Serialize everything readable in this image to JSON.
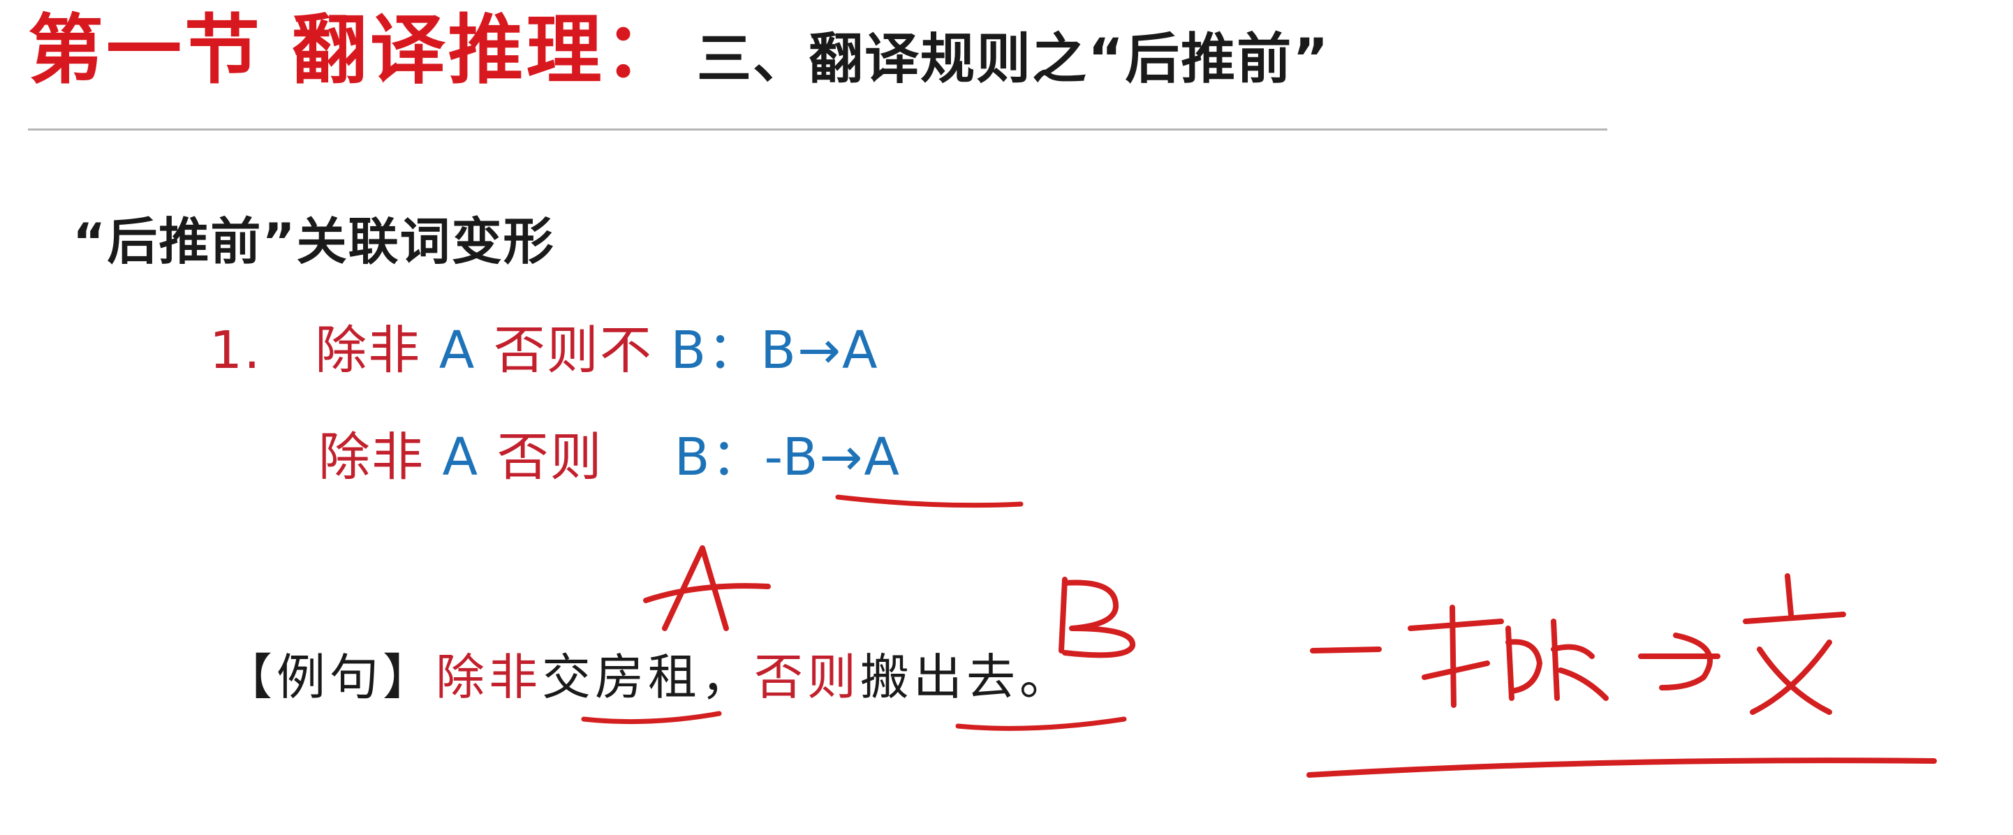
{
  "title": {
    "section": "第一节 翻译推理：",
    "topic": "三、翻译规则之“后推前”"
  },
  "subheading": "“后推前”关联词变形",
  "rules": [
    {
      "number": "1.",
      "red_a": "除非",
      "blue_a": "A",
      "red_b": "否则不",
      "blue_b": "B：B→A"
    },
    {
      "red_a": "除非",
      "blue_a": "A",
      "red_b": "否则",
      "blue_b": "B：-B→A"
    }
  ],
  "example": {
    "bracket": "【例句】",
    "red_1": "除非",
    "black_1": "交房租，",
    "red_2": "否则",
    "black_2": "搬出去。"
  },
  "annotations": {
    "label_a": "A",
    "label_b": "B",
    "handwritten_formula": "-搬→交",
    "ink_color": "#d31f1f"
  }
}
